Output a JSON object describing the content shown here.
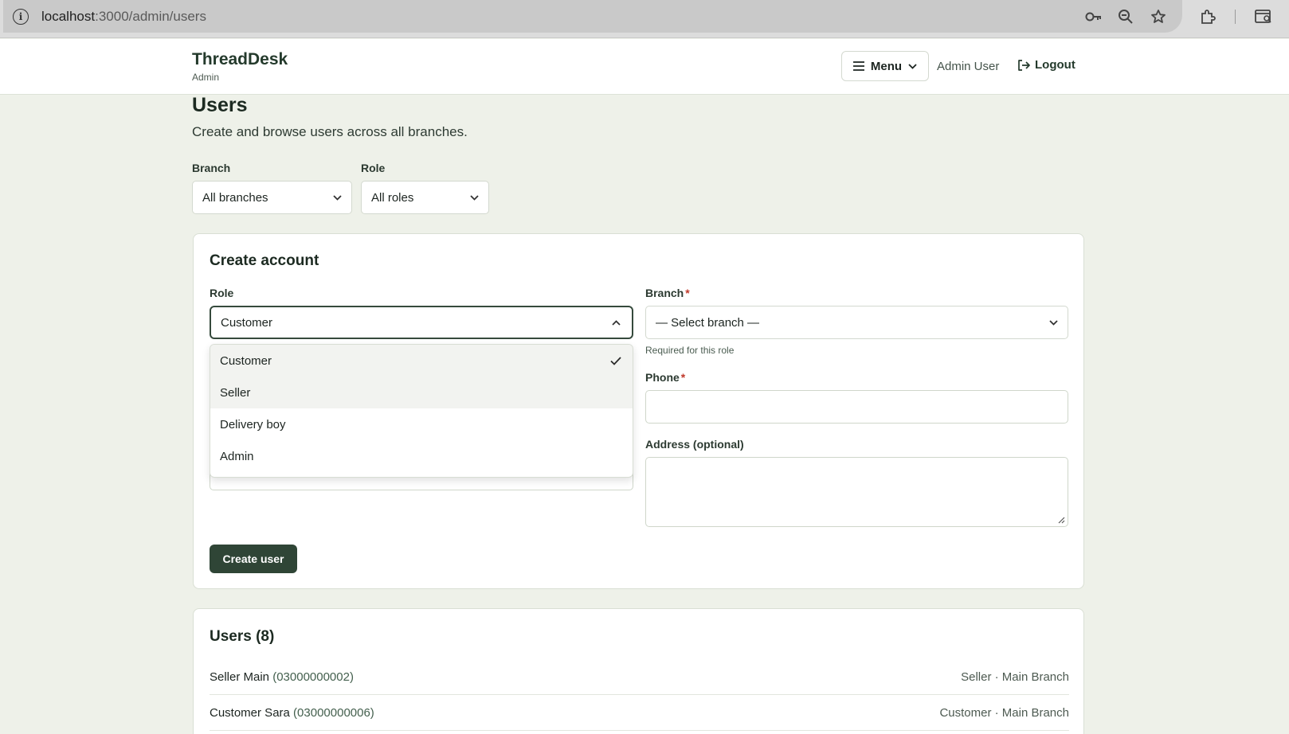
{
  "browser": {
    "url_host": "localhost",
    "url_path": ":3000/admin/users",
    "icons": [
      "info-icon",
      "key-icon",
      "zoom-icon",
      "star-icon",
      "extensions-icon",
      "sidepanel-icon"
    ]
  },
  "header": {
    "brand": "ThreadDesk",
    "brand_sub": "Admin",
    "menu_label": "Menu",
    "user_name": "Admin User",
    "logout_label": "Logout"
  },
  "page": {
    "title": "Users",
    "subtitle": "Create and browse users across all branches."
  },
  "filters": {
    "branch_label": "Branch",
    "branch_value": "All branches",
    "role_label": "Role",
    "role_value": "All roles"
  },
  "create": {
    "title": "Create account",
    "role_label": "Role",
    "role_value": "Customer",
    "role_options": [
      "Customer",
      "Seller",
      "Delivery boy",
      "Admin"
    ],
    "role_selected_index": 0,
    "branch_label": "Branch",
    "branch_value": "— Select branch —",
    "branch_hint": "Required for this role",
    "phone_label": "Phone",
    "address_label": "Address (optional)",
    "required_mark": "*",
    "submit_label": "Create user"
  },
  "users": {
    "title": "Users (8)",
    "rows": [
      {
        "name": "Seller Main",
        "phone": "(03000000002)",
        "meta": "Seller · Main Branch"
      },
      {
        "name": "Customer Sara",
        "phone": "(03000000006)",
        "meta": "Customer · Main Branch"
      }
    ]
  },
  "colors": {
    "page_bg": "#eef1e9",
    "accent": "#2f4536",
    "brand": "#243a2c"
  }
}
